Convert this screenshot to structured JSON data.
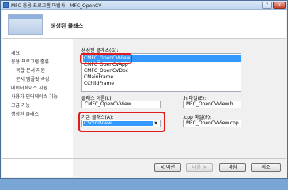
{
  "window": {
    "title": "MFC 응용 프로그램 마법사 - MFC_OpenCV",
    "help_glyph": "?",
    "close_glyph": "✕"
  },
  "banner": {
    "heading": "생성된 클래스"
  },
  "nav": {
    "items": [
      "개요",
      "응용 프로그램 종류",
      "복합 문서 지원",
      "문서 템플릿 속성",
      "데이터베이스 지원",
      "사용자 인터페이스 기능",
      "고급 기능",
      "생성된 클래스"
    ]
  },
  "classes": {
    "label": "생성된 클래스(G):",
    "items": [
      "CMFC_OpenCVView",
      "CMFC_OpenCVApp",
      "CMFC_OpenCVDoc",
      "CMainFrame",
      "CChildFrame"
    ],
    "selected": "CMFC_OpenCVView"
  },
  "form": {
    "class_name_label": "클래스 이름(L):",
    "class_name_value": "CMFC_OpenCVView",
    "h_file_label": ".h 파일(E):",
    "h_file_value": "MFC_OpenCVView.h",
    "base_class_label": "기본 클래스(A):",
    "base_class_value": "CScrollView",
    "cpp_file_label": ".cpp 파일(P):",
    "cpp_file_value": "MFC_OpenCVView.cpp"
  },
  "buttons": {
    "prev": "< 이전",
    "next": "다음 >",
    "finish": "마침",
    "cancel": "취소"
  },
  "colors": {
    "highlight": "#e01c1c",
    "selection": "#3399ff"
  }
}
